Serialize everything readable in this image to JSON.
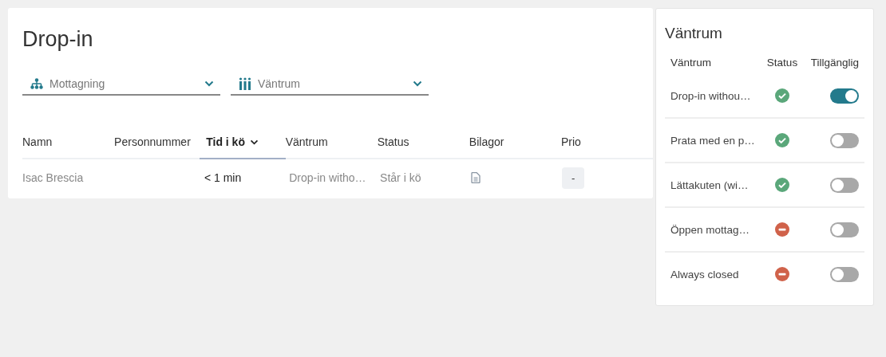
{
  "page": {
    "title": "Drop-in"
  },
  "filters": [
    {
      "kind": "tree",
      "label": "Mottagning"
    },
    {
      "kind": "bars",
      "label": "Väntrum"
    }
  ],
  "table": {
    "columns": [
      {
        "label": "Namn",
        "sorted": false
      },
      {
        "label": "Personnummer",
        "sorted": false
      },
      {
        "label": "Tid i kö",
        "sorted": true
      },
      {
        "label": "Väntrum",
        "sorted": false
      },
      {
        "label": "Status",
        "sorted": false
      },
      {
        "label": "Bilagor",
        "sorted": false
      },
      {
        "label": "Prio",
        "sorted": false
      }
    ],
    "rows": [
      {
        "name": "Isac Brescia",
        "time": "< 1 min",
        "room": "Drop-in witho…",
        "status": "Står i kö",
        "attachment": true,
        "prio": "-"
      }
    ]
  },
  "side_panel": {
    "title": "Väntrum",
    "columns": [
      "Väntrum",
      "Status",
      "Tillgänglig"
    ],
    "rooms": [
      {
        "name": "Drop-in withou…",
        "open": true,
        "on": true
      },
      {
        "name": "Prata med en p…",
        "open": true,
        "on": false
      },
      {
        "name": "Lättakuten (wi…",
        "open": true,
        "on": false
      },
      {
        "name": "Öppen mottag…",
        "open": false,
        "on": false
      },
      {
        "name": "Always closed",
        "open": false,
        "on": false
      }
    ]
  }
}
